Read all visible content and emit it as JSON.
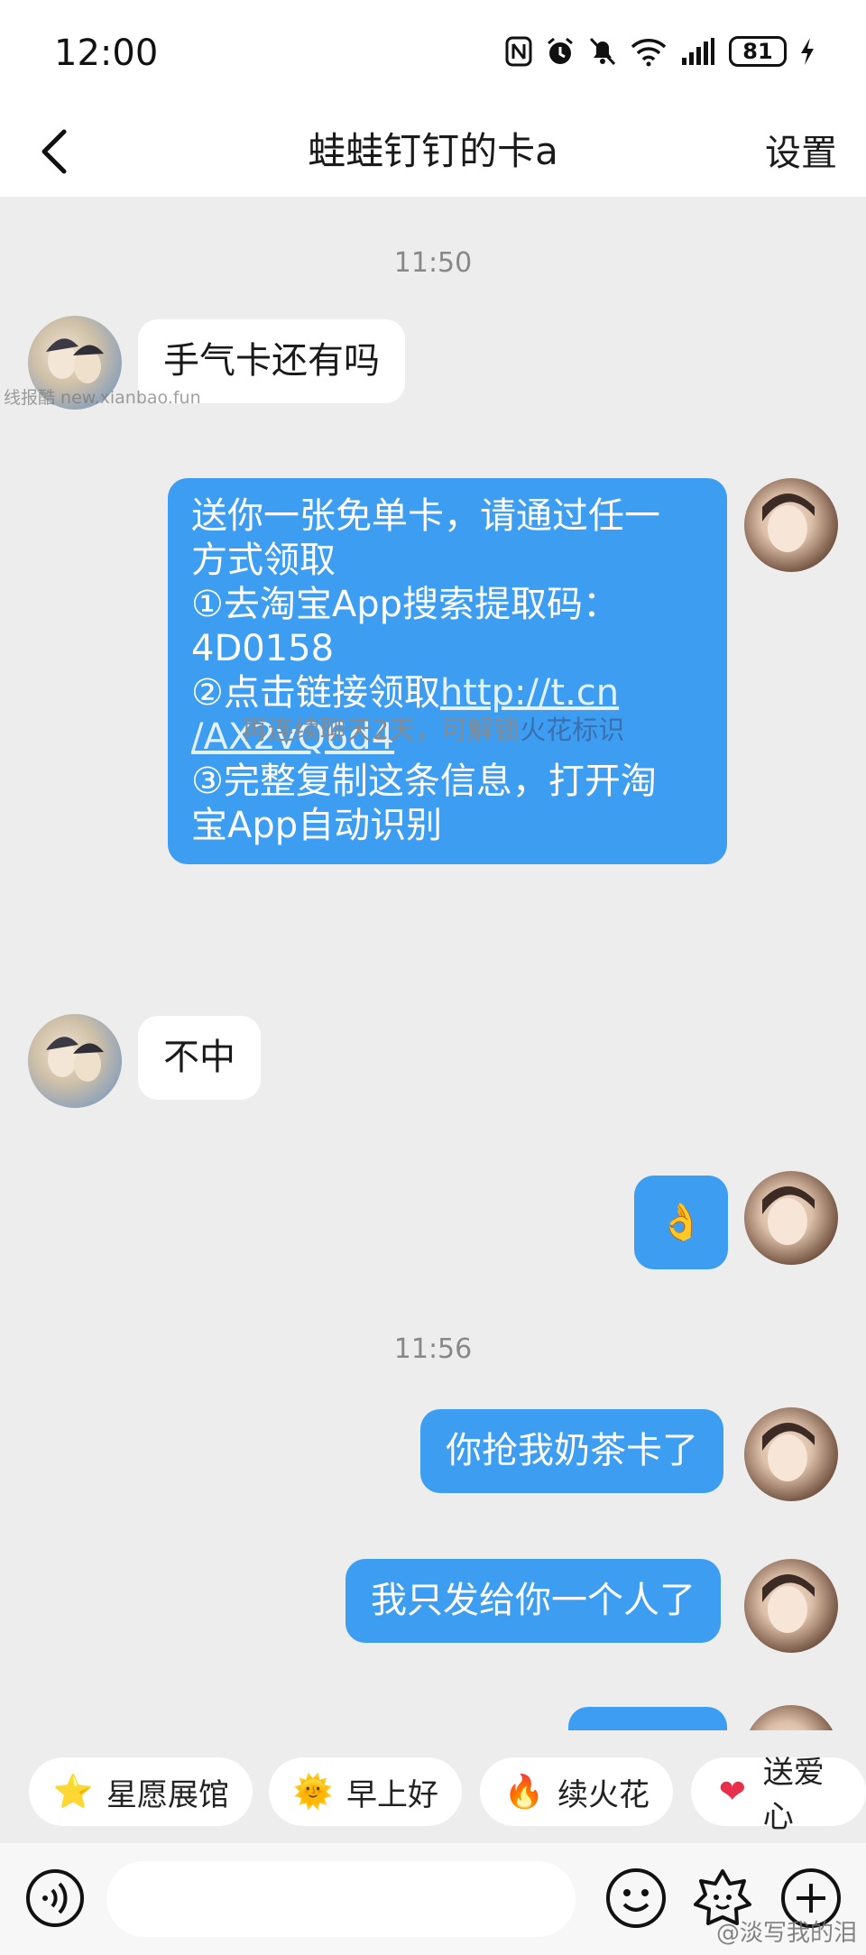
{
  "status_bar": {
    "time": "12:00",
    "battery": "81"
  },
  "header": {
    "back_icon": "chevron-left-icon",
    "title": "蛙蛙钉钉的卡a",
    "settings": "设置"
  },
  "messages": {
    "ts1": "11:50",
    "m1": "手气卡还有吗",
    "watermark": "线报酷 new.xianbao.fun",
    "m2": [
      "送你一张免单卡，请通过任一",
      "方式领取",
      "①去淘宝App搜索提取码：",
      "4D0158",
      "②点击链接领取",
      "http://t.cn",
      "/AX2vQ6d4",
      "③完整复制这条信息，打开淘",
      "宝App自动识别"
    ],
    "hint_prefix": "再连续聊天2天，可解锁",
    "hint_link": "火花标识",
    "m3": "不中",
    "m4_emoji": "👌",
    "ts2": "11:56",
    "m5": "你抢我奶茶卡了",
    "m6": "我只发给你一个人了"
  },
  "quick_replies": [
    {
      "icon": "⭐",
      "icon_name": "star-icon",
      "label": "星愿展馆"
    },
    {
      "icon": "🌞",
      "icon_name": "sun-icon",
      "label": "早上好"
    },
    {
      "icon": "🔥",
      "icon_name": "fire-icon",
      "label": "续火花"
    },
    {
      "icon": "❤",
      "icon_name": "heart-icon",
      "label": "送爱心"
    }
  ],
  "input_bar": {
    "placeholder": "",
    "weibo_watermark": "@淡写我的泪"
  },
  "colors": {
    "bubble_out": "#3d9df1",
    "bubble_in": "#ffffff",
    "link": "#3a6fb0",
    "background": "#ededed"
  }
}
